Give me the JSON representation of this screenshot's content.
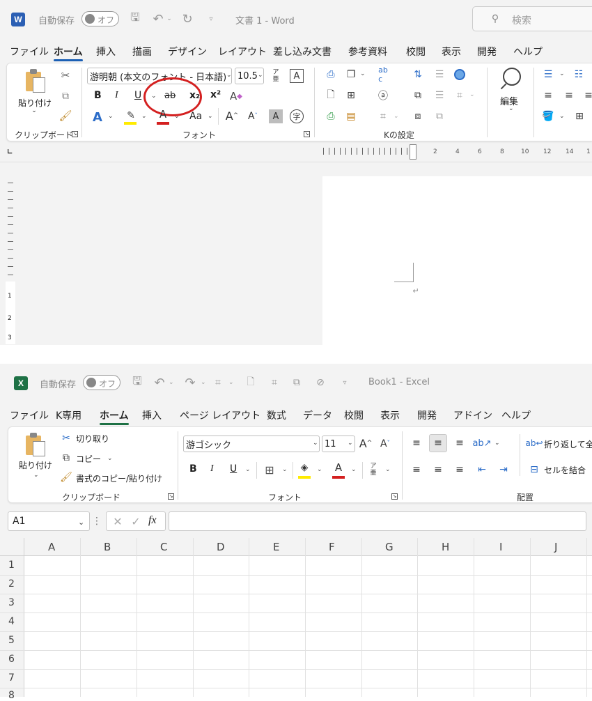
{
  "word": {
    "app_icon": "word-logo-icon",
    "autosave_label": "自動保存",
    "autosave_toggle": "オフ",
    "title": "文書 1  -  Word",
    "search_placeholder": "検索",
    "tabs": [
      "ファイル",
      "ホーム",
      "挿入",
      "描画",
      "デザイン",
      "レイアウト",
      "差し込み文書",
      "参考資料",
      "校閲",
      "表示",
      "開発",
      "ヘルプ"
    ],
    "active_tab": "ホーム",
    "clipboard": {
      "paste_label": "貼り付け",
      "group_label": "クリップボード"
    },
    "font": {
      "font_name": "游明朝 (本文のフォント - 日本語)",
      "font_size": "10.5",
      "group_label": "フォント",
      "bold": "B",
      "italic": "I",
      "underline": "U",
      "strike": "ab",
      "subscript": "x₂",
      "superscript": "x²",
      "change_case": "Aa",
      "grow": "A",
      "shrink": "A"
    },
    "paragraph_group_label": "Kの設定",
    "editing_label": "編集",
    "ruler_numbers": [
      "2",
      "4",
      "6",
      "8",
      "10",
      "12",
      "14",
      "1"
    ],
    "vertical_ruler_numbers": [
      "1",
      "2",
      "3"
    ],
    "highlight_color": "#d42020"
  },
  "excel": {
    "app_icon": "excel-logo-icon",
    "autosave_label": "自動保存",
    "autosave_toggle": "オフ",
    "title": "Book1  -  Excel",
    "tabs": [
      "ファイル",
      "K専用",
      "ホーム",
      "挿入",
      "ページ レイアウト",
      "数式",
      "データ",
      "校閲",
      "表示",
      "開発",
      "アドイン",
      "ヘルプ"
    ],
    "active_tab": "ホーム",
    "clipboard": {
      "paste_label": "貼り付け",
      "cut_label": "切り取り",
      "copy_label": "コピー",
      "format_painter_label": "書式のコピー/貼り付け",
      "group_label": "クリップボード"
    },
    "font": {
      "font_name": "游ゴシック",
      "font_size": "11",
      "group_label": "フォント",
      "bold": "B",
      "italic": "I",
      "underline": "U"
    },
    "alignment": {
      "wrap_label": "折り返して全",
      "merge_label": "セルを結合",
      "group_label": "配置"
    },
    "name_box": "A1",
    "fx_label": "fx",
    "columns": [
      "A",
      "B",
      "C",
      "D",
      "E",
      "F",
      "G",
      "H",
      "I",
      "J"
    ],
    "rows": [
      "1",
      "2",
      "3",
      "4",
      "5",
      "6",
      "7",
      "8"
    ]
  }
}
